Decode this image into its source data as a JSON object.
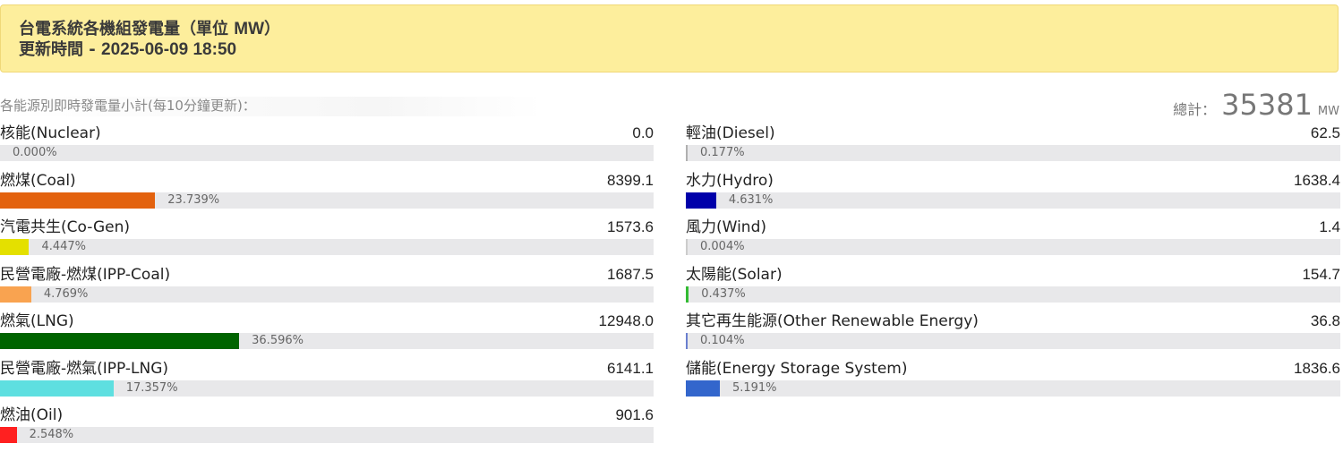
{
  "header": {
    "title_prefix": "台電系統各機組發電量（單位 ",
    "title_unit": "MW",
    "title_suffix": "）",
    "updated_prefix": "更新時間 - ",
    "updated_time": "2025-06-09 18:50",
    "bg_color": "#fdee9c"
  },
  "summary": {
    "subtitle": "各能源別即時發電量小計(每10分鐘更新)：",
    "total_label": "總計：",
    "total_value": "35381",
    "total_unit": "MW"
  },
  "left": [
    {
      "name": "核能(Nuclear)",
      "value": "0.0",
      "pct": "0.000%",
      "share": 0.0,
      "color": "#cccccc"
    },
    {
      "name": "燃煤(Coal)",
      "value": "8399.1",
      "pct": "23.739%",
      "share": 23.739,
      "color": "#e3620e"
    },
    {
      "name": "汽電共生(Co-Gen)",
      "value": "1573.6",
      "pct": "4.447%",
      "share": 4.447,
      "color": "#e4e000"
    },
    {
      "name": "民營電廠-燃煤(IPP-Coal)",
      "value": "1687.5",
      "pct": "4.769%",
      "share": 4.769,
      "color": "#f9a350"
    },
    {
      "name": "燃氣(LNG)",
      "value": "12948.0",
      "pct": "36.596%",
      "share": 36.596,
      "color": "#006400"
    },
    {
      "name": "民營電廠-燃氣(IPP-LNG)",
      "value": "6141.1",
      "pct": "17.357%",
      "share": 17.357,
      "color": "#5edfe0"
    },
    {
      "name": "燃油(Oil)",
      "value": "901.6",
      "pct": "2.548%",
      "share": 2.548,
      "color": "#ff2020"
    }
  ],
  "right": [
    {
      "name": "輕油(Diesel)",
      "value": "62.5",
      "pct": "0.177%",
      "share": 0.177,
      "color": "#b0b0b0"
    },
    {
      "name": "水力(Hydro)",
      "value": "1638.4",
      "pct": "4.631%",
      "share": 4.631,
      "color": "#0000aa"
    },
    {
      "name": "風力(Wind)",
      "value": "1.4",
      "pct": "0.004%",
      "share": 0.004,
      "color": "#cccccc"
    },
    {
      "name": "太陽能(Solar)",
      "value": "154.7",
      "pct": "0.437%",
      "share": 0.437,
      "color": "#33bb33"
    },
    {
      "name": "其它再生能源(Other Renewable Energy)",
      "value": "36.8",
      "pct": "0.104%",
      "share": 0.104,
      "color": "#6a7fcf"
    },
    {
      "name": "儲能(Energy Storage System)",
      "value": "1836.6",
      "pct": "5.191%",
      "share": 5.191,
      "color": "#3366cc"
    }
  ]
}
